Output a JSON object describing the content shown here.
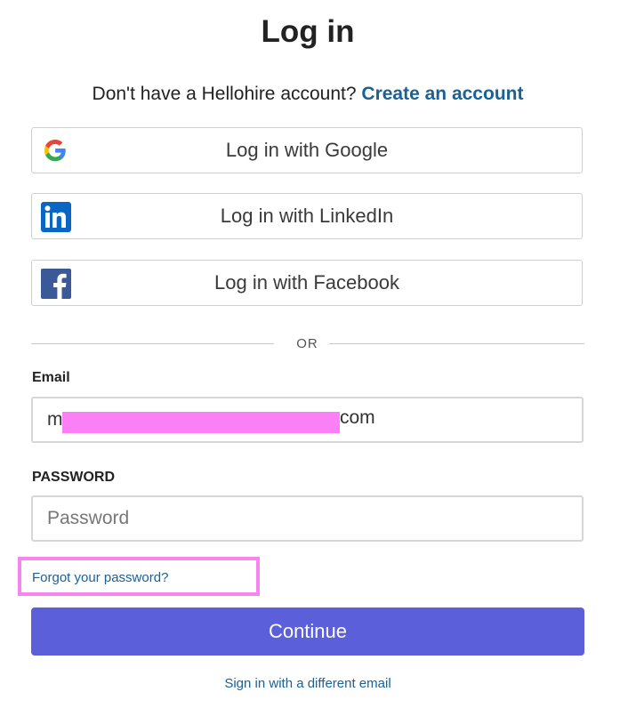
{
  "page": {
    "title": "Log in",
    "signup_prompt": "Don't have a Hellohire account?",
    "signup_link": "Create an account"
  },
  "social": {
    "google": {
      "label": "Log in with Google",
      "icon": "google-icon"
    },
    "linkedin": {
      "label": "Log in with LinkedIn",
      "icon": "linkedin-icon"
    },
    "facebook": {
      "label": "Log in with Facebook",
      "icon": "facebook-icon"
    }
  },
  "divider": {
    "text": "OR"
  },
  "email": {
    "label": "Email",
    "value_start": "m",
    "value_end": "com"
  },
  "password": {
    "label": "PASSWORD",
    "placeholder": "Password",
    "value": ""
  },
  "forgot_link": "Forgot your password?",
  "continue_button": "Continue",
  "different_email_link": "Sign in with a different email",
  "colors": {
    "primary": "#5b5fd9",
    "link": "#1a6196",
    "highlight": "#f685f2",
    "redaction": "#fb7ff5"
  }
}
